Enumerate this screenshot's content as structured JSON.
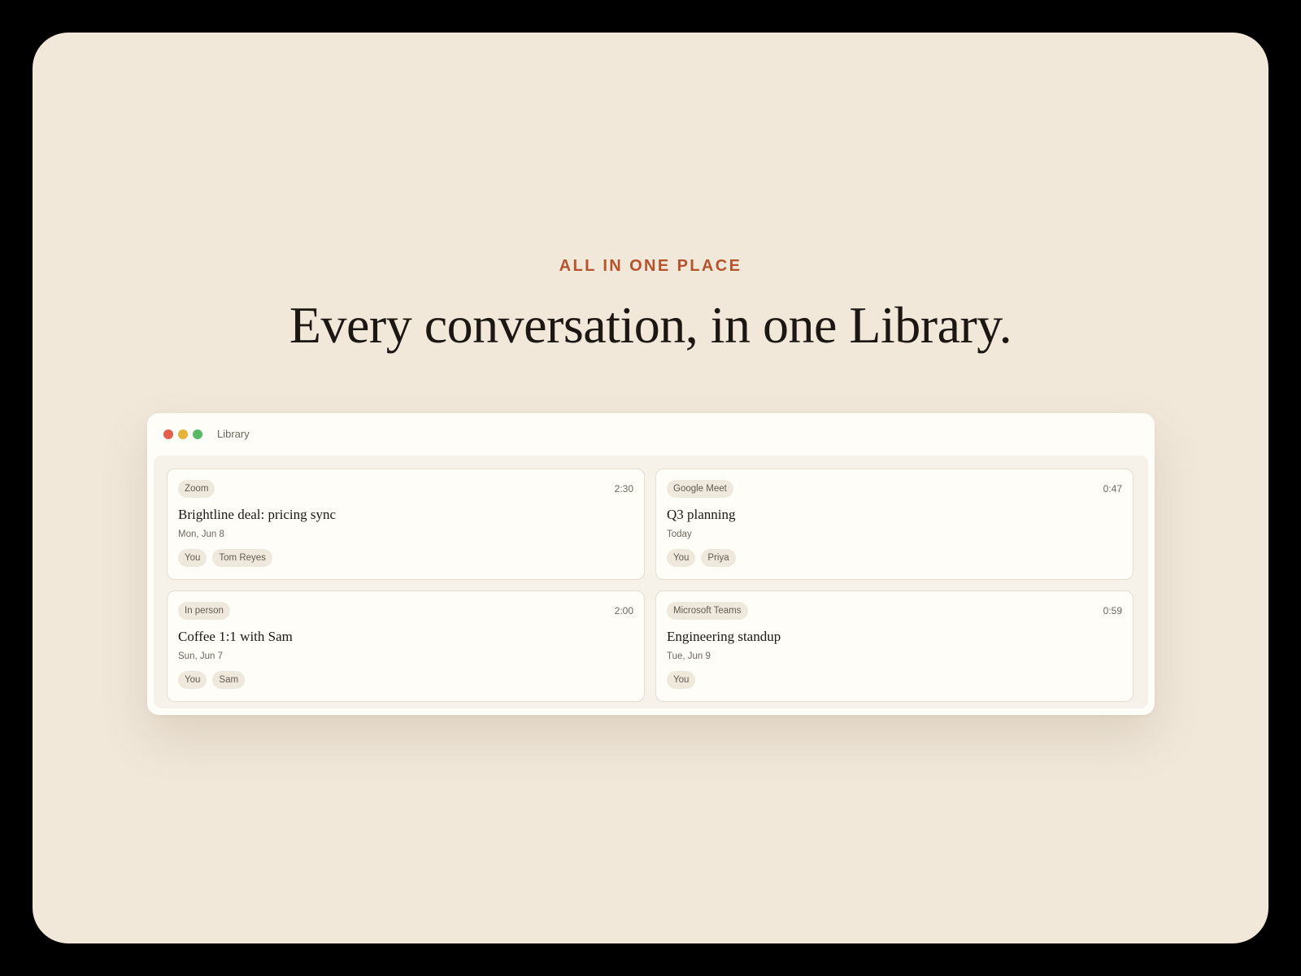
{
  "hero": {
    "eyebrow": "ALL IN ONE PLACE",
    "headline": "Every conversation, in one Library."
  },
  "window": {
    "title": "Library",
    "controls": [
      "close",
      "minimize",
      "maximize"
    ]
  },
  "cards": [
    {
      "source": "Zoom",
      "duration": "2:30",
      "title": "Brightline deal: pricing sync",
      "date": "Mon, Jun 8",
      "participants": [
        "You",
        "Tom Reyes"
      ]
    },
    {
      "source": "Google Meet",
      "duration": "0:47",
      "title": "Q3 planning",
      "date": "Today",
      "participants": [
        "You",
        "Priya"
      ]
    },
    {
      "source": "In person",
      "duration": "2:00",
      "title": "Coffee 1:1 with Sam",
      "date": "Sun, Jun 7",
      "participants": [
        "You",
        "Sam"
      ]
    },
    {
      "source": "Microsoft Teams",
      "duration": "0:59",
      "title": "Engineering standup",
      "date": "Tue, Jun 9",
      "participants": [
        "You"
      ]
    }
  ],
  "colors": {
    "background": "#f1e8da",
    "accent": "#b4532c",
    "window": "#fffdf8",
    "close": "#e0604c",
    "minimize": "#e5b23a",
    "maximize": "#58b865"
  }
}
